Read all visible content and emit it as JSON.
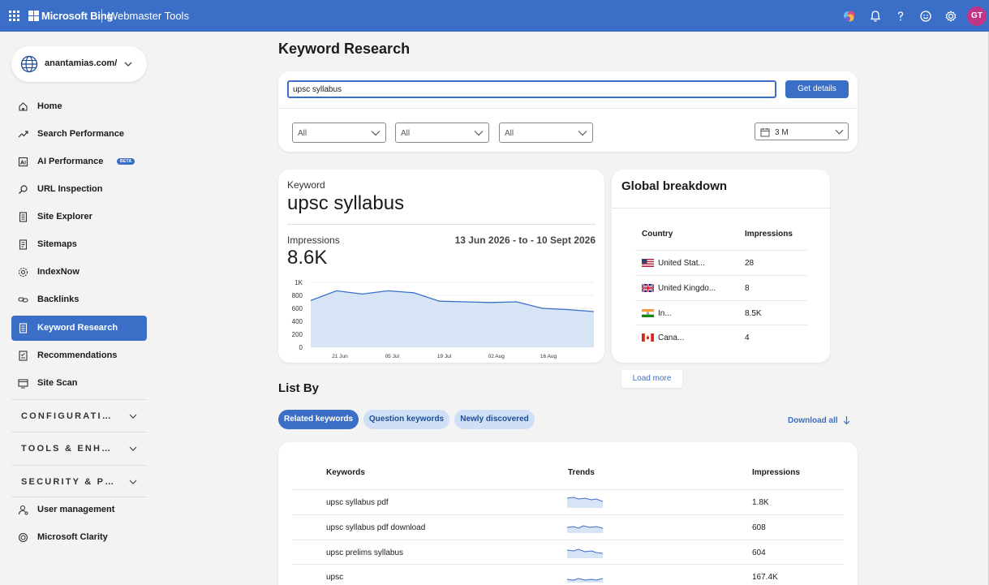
{
  "header": {
    "brand": "Microsoft Bing",
    "product": "Webmaster Tools",
    "avatar_initials": "GT",
    "accent": "#3b6fc7"
  },
  "sidebar": {
    "site": "anantamias.com/",
    "items": [
      {
        "label": "Home",
        "icon": "home-icon"
      },
      {
        "label": "Search Performance",
        "icon": "trend-icon"
      },
      {
        "label": "AI Performance",
        "icon": "ai-icon",
        "badge": "BETA"
      },
      {
        "label": "URL Inspection",
        "icon": "search-icon"
      },
      {
        "label": "Site Explorer",
        "icon": "document-icon"
      },
      {
        "label": "Sitemaps",
        "icon": "sitemap-icon"
      },
      {
        "label": "IndexNow",
        "icon": "gear-icon"
      },
      {
        "label": "Backlinks",
        "icon": "link-icon"
      },
      {
        "label": "Keyword Research",
        "icon": "document-icon",
        "active": true
      },
      {
        "label": "Recommendations",
        "icon": "checklist-icon"
      },
      {
        "label": "Site Scan",
        "icon": "scan-icon"
      }
    ],
    "sections": [
      "CONFIGURATION",
      "TOOLS & ENHANCEMENTS",
      "SECURITY & PRIVACY"
    ],
    "bottom_items": [
      {
        "label": "User management",
        "icon": "user-icon"
      },
      {
        "label": "Microsoft Clarity",
        "icon": "clarity-icon"
      }
    ]
  },
  "main": {
    "title": "Keyword Research",
    "search": {
      "value": "upsc syllabus",
      "button": "Get details"
    },
    "filters": [
      "All",
      "All",
      "All"
    ],
    "date_filter": "3 M"
  },
  "keyword_card": {
    "label": "Keyword",
    "keyword": "upsc syllabus",
    "impressions_label": "Impressions",
    "impressions_value": "8.6K",
    "date_range": "13 Jun 2026 - to - 10 Sept 2026"
  },
  "chart_data": {
    "type": "area",
    "y_ticks": [
      "1K",
      "800",
      "600",
      "400",
      "200",
      "0"
    ],
    "x_ticks": [
      "21 Jun",
      "05 Jul",
      "19 Jul",
      "02 Aug",
      "16 Aug"
    ],
    "ylim": [
      0,
      1000
    ],
    "values": [
      720,
      870,
      820,
      870,
      840,
      710,
      700,
      690,
      700,
      600,
      580,
      550
    ],
    "color": "#3b6fc7",
    "fill": "#d6e4f5"
  },
  "global_breakdown": {
    "title": "Global breakdown",
    "headers": [
      "Country",
      "Impressions"
    ],
    "rows": [
      {
        "country": "United Stat...",
        "flag": "us-flag-icon",
        "impressions": "28"
      },
      {
        "country": "United Kingdo...",
        "flag": "uk-flag-icon",
        "impressions": "8"
      },
      {
        "country": "In...",
        "flag": "india-flag-icon",
        "impressions": "8.5K"
      },
      {
        "country": "Cana...",
        "flag": "canada-flag-icon",
        "impressions": "4"
      }
    ],
    "load_more": "Load more"
  },
  "list_by": {
    "title": "List By",
    "tabs": [
      "Related keywords",
      "Question keywords",
      "Newly discovered"
    ],
    "download": "Download all",
    "headers": [
      "Keywords",
      "Trends",
      "Impressions"
    ],
    "rows": [
      {
        "keyword": "upsc syllabus pdf",
        "impressions": "1.8K"
      },
      {
        "keyword": "upsc syllabus pdf download",
        "impressions": "608"
      },
      {
        "keyword": "upsc prelims syllabus",
        "impressions": "604"
      },
      {
        "keyword": "upsc",
        "impressions": "167.4K"
      }
    ]
  }
}
